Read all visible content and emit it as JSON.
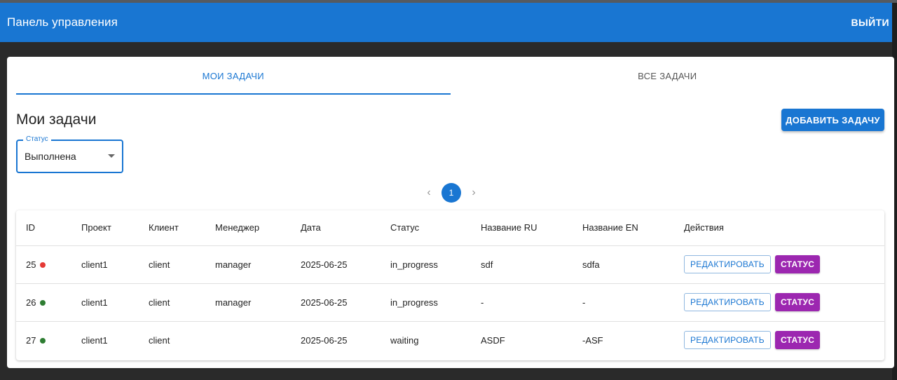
{
  "appbar": {
    "title": "Панель управления",
    "logout_label": "ВЫЙТИ"
  },
  "tabs": [
    {
      "label": "МОИ ЗАДАЧИ",
      "active": true
    },
    {
      "label": "ВСЕ ЗАДАЧИ",
      "active": false
    }
  ],
  "heading": "Мои задачи",
  "add_button_label": "ДОБАВИТЬ ЗАДАЧУ",
  "status_filter": {
    "label": "Статус",
    "value": "Выполнена"
  },
  "pagination": {
    "current_page": "1"
  },
  "table": {
    "columns": [
      "ID",
      "Проект",
      "Клиент",
      "Менеджер",
      "Дата",
      "Статус",
      "Название RU",
      "Название EN",
      "Действия"
    ],
    "rows": [
      {
        "id": "25",
        "indicator_color": "#e53935",
        "project": "client1",
        "client": "client",
        "manager": "manager",
        "date": "2025-06-25",
        "status": "in_progress",
        "name_ru": "sdf",
        "name_en": "sdfa"
      },
      {
        "id": "26",
        "indicator_color": "#2e7d32",
        "project": "client1",
        "client": "client",
        "manager": "manager",
        "date": "2025-06-25",
        "status": "in_progress",
        "name_ru": "-",
        "name_en": "-"
      },
      {
        "id": "27",
        "indicator_color": "#2e7d32",
        "project": "client1",
        "client": "client",
        "manager": "",
        "date": "2025-06-25",
        "status": "waiting",
        "name_ru": "ASDF",
        "name_en": "-ASF"
      }
    ],
    "edit_label": "РЕДАКТИРОВАТЬ",
    "status_label": "СТАТУС"
  },
  "colors": {
    "primary": "#1976d2",
    "secondary": "#9c27b0"
  }
}
